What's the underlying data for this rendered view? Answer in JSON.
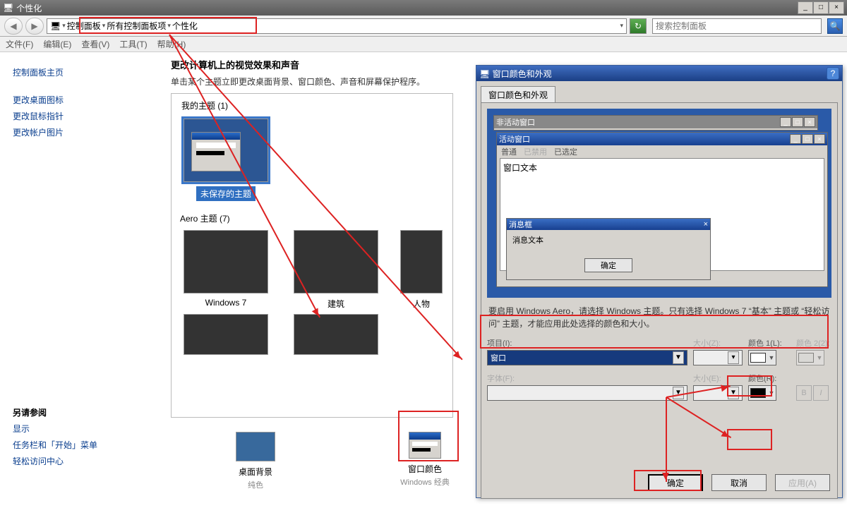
{
  "window": {
    "title": "个性化"
  },
  "winbtns": {
    "min": "_",
    "max": "□",
    "close": "×"
  },
  "breadcrumb": {
    "a": "控制面板",
    "b": "所有控制面板项",
    "c": "个性化",
    "sep": "▾"
  },
  "search": {
    "placeholder": "搜索控制面板"
  },
  "menus": {
    "file": "文件(F)",
    "edit": "编辑(E)",
    "view": "查看(V)",
    "tools": "工具(T)",
    "help": "帮助(H)"
  },
  "sidebar": {
    "home": "控制面板主页",
    "links1": [
      "更改桌面图标",
      "更改鼠标指针",
      "更改帐户图片"
    ],
    "seealso": "另请参阅",
    "links2": [
      "显示",
      "任务栏和「开始」菜单",
      "轻松访问中心"
    ]
  },
  "main": {
    "h": "更改计算机上的视觉效果和声音",
    "sub": "单击某个主题立即更改桌面背景、窗口颜色、声音和屏幕保护程序。",
    "mythemes": "我的主题 (1)",
    "unsaved": "未保存的主题",
    "aero": "Aero 主题 (7)",
    "aerothumbs": [
      "Windows 7",
      "建筑",
      "人物"
    ],
    "bgLabel": "桌面背景",
    "bgSub": "纯色",
    "wcLabel": "窗口颜色",
    "wcSub": "Windows 经典"
  },
  "dialog": {
    "title": "窗口颜色和外观",
    "tab": "窗口颜色和外观",
    "inactive": "非活动窗口",
    "active": "活动窗口",
    "tabs": {
      "normal": "普通",
      "disabled": "已禁用",
      "selected": "已选定"
    },
    "wintext": "窗口文本",
    "msgtitle": "消息框",
    "msgtext": "消息文本",
    "msgok": "确定",
    "note": "要启用 Windows Aero，请选择 Windows 主题。只有选择 Windows 7 “基本” 主题或 “轻松访问” 主题，才能应用此处选择的颜色和大小。",
    "labels": {
      "item": "项目(I):",
      "size": "大小(Z):",
      "color1": "颜色 1(L):",
      "color2": "颜色 2(2):",
      "font": "字体(F):",
      "fsize": "大小(E):",
      "fcolor": "颜色(R):"
    },
    "itemval": "窗口",
    "btns": {
      "ok": "确定",
      "cancel": "取消",
      "apply": "应用(A)"
    },
    "help": "?"
  }
}
